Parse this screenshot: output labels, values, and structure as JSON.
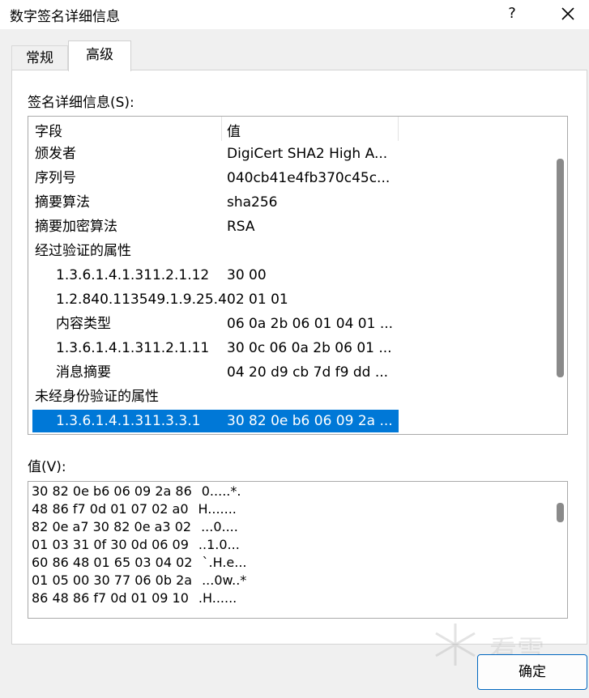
{
  "window": {
    "title": "数字签名详细信息",
    "help_label": "?",
    "close_label": "×"
  },
  "tabs": [
    {
      "label": "常规",
      "active": false
    },
    {
      "label": "高级",
      "active": true
    }
  ],
  "details": {
    "label": "签名详细信息(S):",
    "columns": [
      "字段",
      "值"
    ],
    "rows": [
      {
        "field": "颁发者",
        "value": "DigiCert SHA2 High A...",
        "indent": false,
        "selected": false
      },
      {
        "field": "序列号",
        "value": "040cb41e4fb370c45c...",
        "indent": false,
        "selected": false
      },
      {
        "field": "摘要算法",
        "value": "sha256",
        "indent": false,
        "selected": false
      },
      {
        "field": "摘要加密算法",
        "value": "RSA",
        "indent": false,
        "selected": false
      },
      {
        "field": "经过验证的属性",
        "value": "",
        "indent": false,
        "selected": false
      },
      {
        "field": "1.3.6.1.4.1.311.2.1.12",
        "value": "30 00",
        "indent": true,
        "selected": false
      },
      {
        "field": "1.2.840.113549.1.9.25.4",
        "value": "02 01 01",
        "indent": true,
        "selected": false
      },
      {
        "field": "内容类型",
        "value": "06 0a 2b 06 01 04 01 ...",
        "indent": true,
        "selected": false
      },
      {
        "field": "1.3.6.1.4.1.311.2.1.11",
        "value": "30 0c 06 0a 2b 06 01 ...",
        "indent": true,
        "selected": false
      },
      {
        "field": "消息摘要",
        "value": "04 20 d9 cb 7d f9 dd ...",
        "indent": true,
        "selected": false
      },
      {
        "field": "未经身份验证的属性",
        "value": "",
        "indent": false,
        "selected": false
      },
      {
        "field": "1.3.6.1.4.1.311.3.3.1",
        "value": "30 82 0e b6 06 09 2a ...",
        "indent": true,
        "selected": true
      }
    ],
    "scroll_position": 0.9
  },
  "value_panel": {
    "label": "值(V):",
    "lines": [
      {
        "hex": "30 82 0e b6 06 09 2a 86",
        "ascii": "0.....*."
      },
      {
        "hex": "48 86 f7 0d 01 07 02 a0",
        "ascii": "H......."
      },
      {
        "hex": "82 0e a7 30 82 0e a3 02",
        "ascii": "...0...."
      },
      {
        "hex": "01 03 31 0f 30 0d 06 09",
        "ascii": "..1.0..."
      },
      {
        "hex": "60 86 48 01 65 03 04 02",
        "ascii": "`.H.e..."
      },
      {
        "hex": "01 05 00 30 77 06 0b 2a",
        "ascii": "...0w..*"
      },
      {
        "hex": "86 48 86 f7 0d 01 09 10",
        "ascii": ".H......"
      }
    ]
  },
  "ok_button": {
    "label": "确定"
  },
  "watermark": {
    "text": "看雪",
    "icon": "snowflake-icon"
  },
  "colors": {
    "selection": "#0078d7",
    "button_border": "#0067c0"
  }
}
